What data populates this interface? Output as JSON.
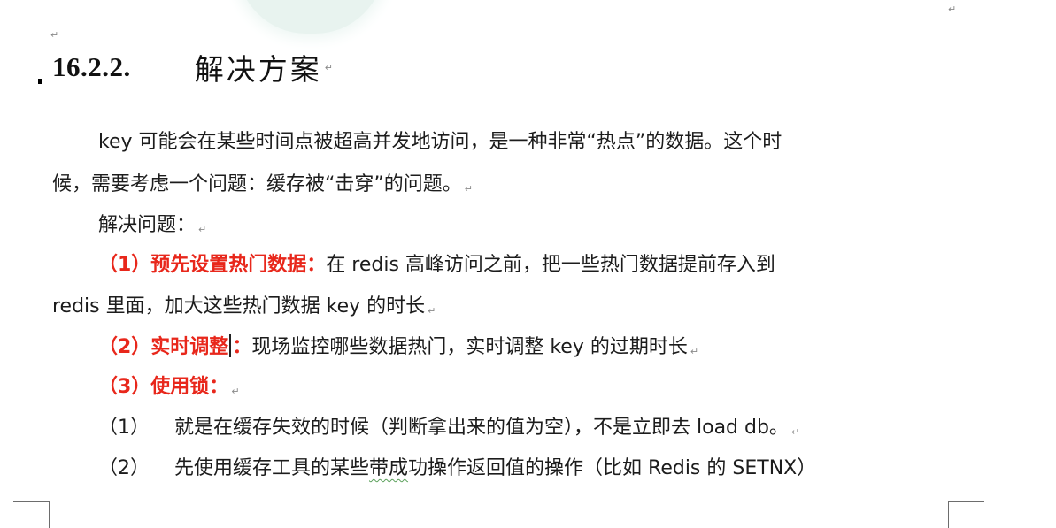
{
  "heading": {
    "number": "16.2.2.",
    "title": "解决方案"
  },
  "paragraph": {
    "line1": "key 可能会在某些时间点被超高并发地访问，是一种非常“热点”的数据。这个时",
    "line2": "候，需要考虑一个问题：缓存被“击穿”的问题。"
  },
  "solutions": {
    "intro": "解决问题：",
    "item1": {
      "label": "（1）预先设置热门数据：",
      "text_line1": "在 redis 高峰访问之前，把一些热门数据提前存入到",
      "text_line2": "redis 里面，加大这些热门数据 key 的时长"
    },
    "item2": {
      "label_part1": "（2）实时调整",
      "label_part2": "：",
      "text": "现场监控哪些数据热门，实时调整 key 的过期时长"
    },
    "item3": {
      "label": "（3）使用锁："
    },
    "sub1": {
      "number": "（1）",
      "text": "就是在缓存失效的时候（判断拿出来的值为空），不是立即去 load db。"
    },
    "sub2": {
      "number": "（2）",
      "text_before": "先使用缓存工具的某些",
      "text_underlined": "带成",
      "text_after": "功操作返回值的操作（比如 Redis 的 SETNX）"
    }
  },
  "paragraph_mark": "↵"
}
